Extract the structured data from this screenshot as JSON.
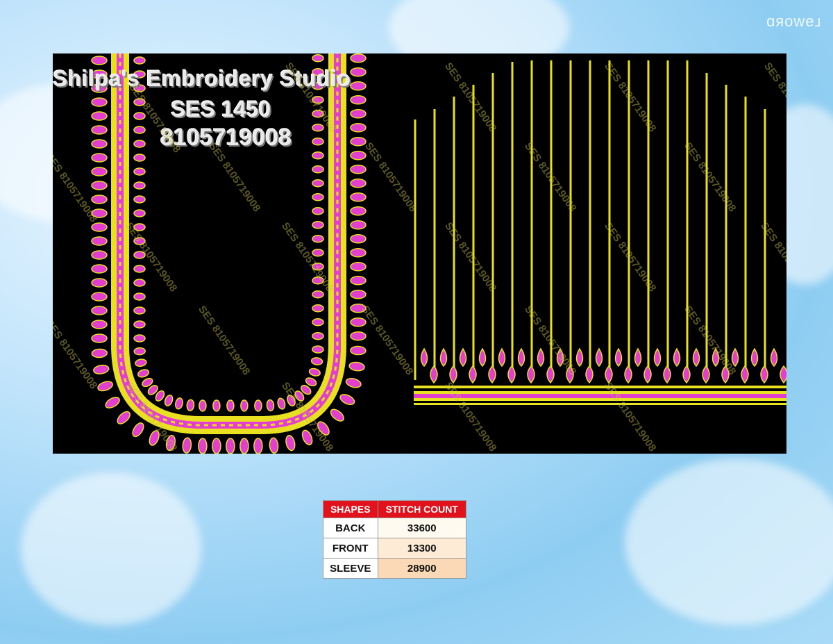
{
  "corner_mark": "ʟɘᴡoʀɒ",
  "brand": {
    "name": "Shilpa's Embroidery Studio",
    "code": "SES  1450",
    "phone": "8105719008"
  },
  "watermark": "SES 8105719008",
  "table": {
    "headers": [
      "SHAPES",
      "STITCH COUNT"
    ],
    "rows": [
      {
        "shape": "BACK",
        "count": "33600"
      },
      {
        "shape": "FRONT",
        "count": "13300"
      },
      {
        "shape": "SLEEVE",
        "count": "28900"
      }
    ]
  },
  "colors": {
    "background": "#9fd6f5",
    "design_bg": "#000000",
    "gold": "#e8e020",
    "magenta": "#e23fd0",
    "header_red": "#e1121b"
  }
}
